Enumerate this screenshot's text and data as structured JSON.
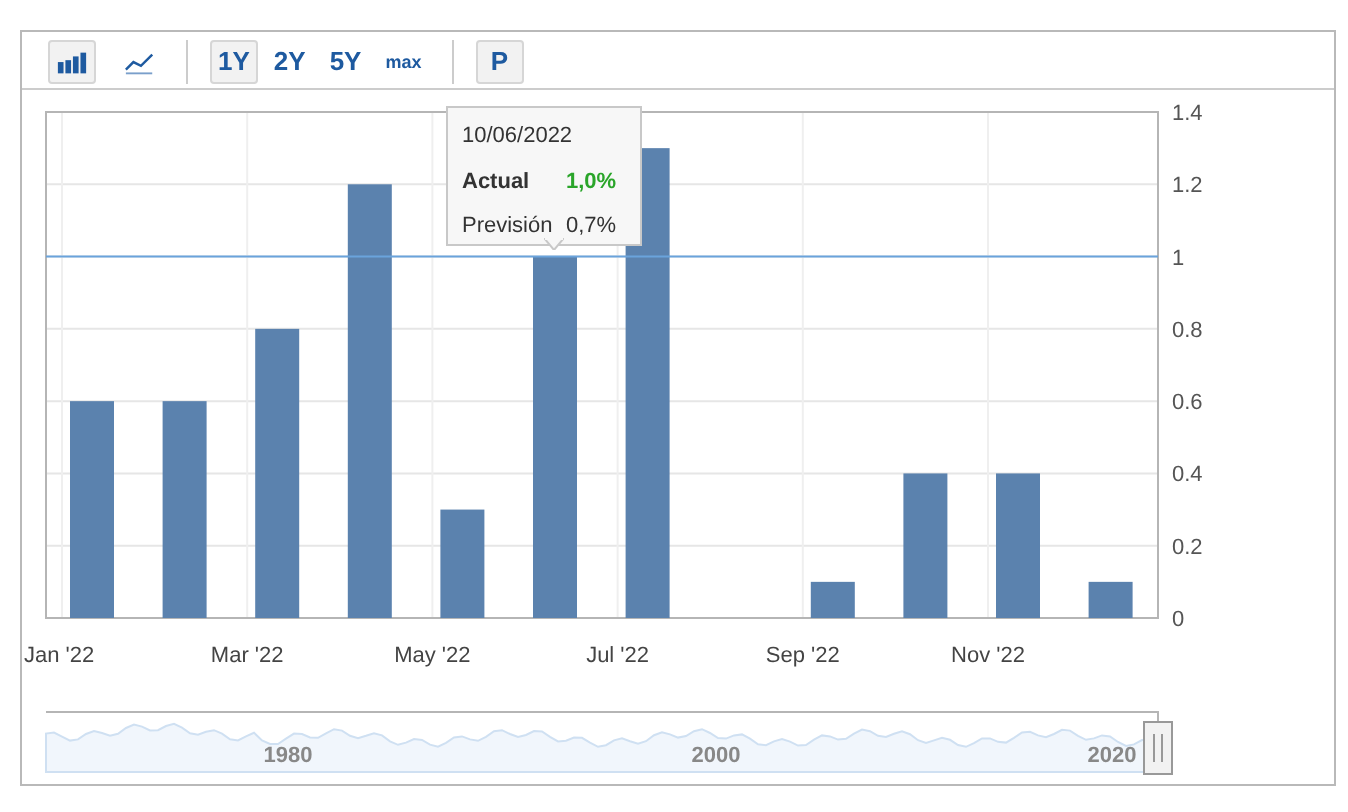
{
  "toolbar": {
    "chart_types": [
      {
        "kind": "bar",
        "selected": true
      },
      {
        "kind": "line",
        "selected": false
      }
    ],
    "periods": [
      {
        "label": "1Y",
        "selected": true
      },
      {
        "label": "2Y",
        "selected": false
      },
      {
        "label": "5Y",
        "selected": false
      },
      {
        "label": "max",
        "selected": false
      }
    ],
    "extra_button": {
      "label": "P"
    }
  },
  "chart": {
    "chart_data": {
      "type": "bar",
      "categories": [
        "Jan '22",
        null,
        "Mar '22",
        null,
        "May '22",
        null,
        "Jul '22",
        null,
        "Sep '22",
        null,
        "Nov '22",
        null
      ],
      "series": [
        {
          "name": "Actual",
          "color": "#5b82ae",
          "values": [
            0.6,
            0.6,
            0.8,
            1.2,
            0.3,
            1.0,
            1.3,
            null,
            0.1,
            0.4,
            0.4,
            0.1
          ]
        }
      ],
      "ylim": [
        0,
        1.4
      ],
      "yticks": [
        0,
        0.2,
        0.4,
        0.6,
        0.8,
        1,
        1.2,
        1.4
      ],
      "grid": true,
      "ref_lines": [
        {
          "axis": "y",
          "value": 1,
          "color": "#6aa3dc"
        }
      ]
    },
    "tooltip": {
      "date": "10/06/2022",
      "actual": "1,0%",
      "forecast_label": "Previsión",
      "forecast": "0,7%"
    }
  },
  "navigator": {
    "labels": [
      "1980",
      "2000",
      "2020"
    ]
  }
}
